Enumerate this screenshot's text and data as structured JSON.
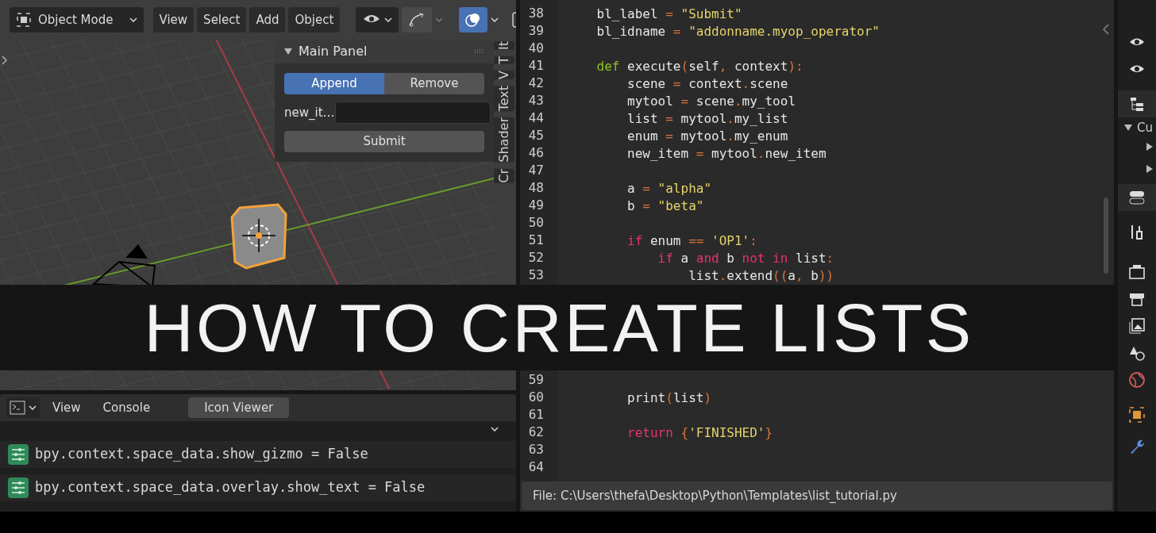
{
  "viewport": {
    "mode": "Object Mode",
    "menus": [
      "View",
      "Select",
      "Add",
      "Object"
    ],
    "overlays_on": true
  },
  "main_panel": {
    "title": "Main Panel",
    "expanded": true,
    "actions": [
      {
        "label": "Append",
        "selected": true
      },
      {
        "label": "Remove",
        "selected": false
      }
    ],
    "field_label": "new_it…",
    "submit": "Submit"
  },
  "sidebar_tabs": [
    "It",
    "T",
    "V",
    "Text",
    "Shader",
    "Cr"
  ],
  "console": {
    "menus": [
      "View",
      "Console"
    ],
    "tabs": [
      {
        "label": "Icon Viewer",
        "selected": true
      }
    ],
    "lines": [
      "bpy.context.space_data.show_gizmo = False",
      "bpy.context.space_data.overlay.show_text = False"
    ]
  },
  "text_editor": {
    "lines": [
      {
        "number": "38",
        "tokens": [
          {
            "text": "    bl_label ",
            "kind": "plain"
          },
          {
            "text": "=",
            "kind": "op"
          },
          {
            "text": " \"Submit\"",
            "kind": "str"
          }
        ]
      },
      {
        "number": "39",
        "tokens": [
          {
            "text": "    bl_idname ",
            "kind": "plain"
          },
          {
            "text": "=",
            "kind": "op"
          },
          {
            "text": " \"addonname.myop_operator\"",
            "kind": "str"
          }
        ]
      },
      {
        "number": "40"
      },
      {
        "number": "41",
        "tokens": [
          {
            "text": "    def",
            "kind": "def"
          },
          {
            "text": " execute",
            "kind": "plain"
          },
          {
            "text": "(",
            "kind": "op"
          },
          {
            "text": "self",
            "kind": "plain"
          },
          {
            "text": ",",
            "kind": "op"
          },
          {
            "text": " context",
            "kind": "plain"
          },
          {
            "text": "):",
            "kind": "op"
          }
        ]
      },
      {
        "number": "42",
        "tokens": [
          {
            "text": "        scene ",
            "kind": "plain"
          },
          {
            "text": "=",
            "kind": "op"
          },
          {
            "text": " context",
            "kind": "plain"
          },
          {
            "text": ".",
            "kind": "op"
          },
          {
            "text": "scene",
            "kind": "plain"
          }
        ]
      },
      {
        "number": "43",
        "tokens": [
          {
            "text": "        mytool ",
            "kind": "plain"
          },
          {
            "text": "=",
            "kind": "op"
          },
          {
            "text": " scene",
            "kind": "plain"
          },
          {
            "text": ".",
            "kind": "op"
          },
          {
            "text": "my_tool",
            "kind": "plain"
          }
        ]
      },
      {
        "number": "44",
        "tokens": [
          {
            "text": "        list ",
            "kind": "plain"
          },
          {
            "text": "=",
            "kind": "op"
          },
          {
            "text": " mytool",
            "kind": "plain"
          },
          {
            "text": ".",
            "kind": "op"
          },
          {
            "text": "my_list",
            "kind": "plain"
          }
        ]
      },
      {
        "number": "45",
        "tokens": [
          {
            "text": "        enum ",
            "kind": "plain"
          },
          {
            "text": "=",
            "kind": "op"
          },
          {
            "text": " mytool",
            "kind": "plain"
          },
          {
            "text": ".",
            "kind": "op"
          },
          {
            "text": "my_enum",
            "kind": "plain"
          }
        ]
      },
      {
        "number": "46",
        "tokens": [
          {
            "text": "        new_item ",
            "kind": "plain"
          },
          {
            "text": "=",
            "kind": "op"
          },
          {
            "text": " mytool",
            "kind": "plain"
          },
          {
            "text": ".",
            "kind": "op"
          },
          {
            "text": "new_item",
            "kind": "plain"
          }
        ]
      },
      {
        "number": "47"
      },
      {
        "number": "48",
        "tokens": [
          {
            "text": "        a ",
            "kind": "plain"
          },
          {
            "text": "=",
            "kind": "op"
          },
          {
            "text": " \"alpha\"",
            "kind": "str"
          }
        ]
      },
      {
        "number": "49",
        "tokens": [
          {
            "text": "        b ",
            "kind": "plain"
          },
          {
            "text": "=",
            "kind": "op"
          },
          {
            "text": " \"beta\"",
            "kind": "str"
          }
        ]
      },
      {
        "number": "50"
      },
      {
        "number": "51",
        "tokens": [
          {
            "text": "        if",
            "kind": "kw"
          },
          {
            "text": " enum ",
            "kind": "plain"
          },
          {
            "text": "==",
            "kind": "op"
          },
          {
            "text": " 'OP1'",
            "kind": "str"
          },
          {
            "text": ":",
            "kind": "op"
          }
        ]
      },
      {
        "number": "52",
        "tokens": [
          {
            "text": "            if",
            "kind": "kw"
          },
          {
            "text": " a ",
            "kind": "plain"
          },
          {
            "text": "and",
            "kind": "kw"
          },
          {
            "text": " b ",
            "kind": "plain"
          },
          {
            "text": "not in",
            "kind": "kw"
          },
          {
            "text": " list",
            "kind": "plain"
          },
          {
            "text": ":",
            "kind": "op"
          }
        ]
      },
      {
        "number": "53",
        "tokens": [
          {
            "text": "                list",
            "kind": "plain"
          },
          {
            "text": ".",
            "kind": "op"
          },
          {
            "text": "extend",
            "kind": "plain"
          },
          {
            "text": "((",
            "kind": "op"
          },
          {
            "text": "a",
            "kind": "plain"
          },
          {
            "text": ",",
            "kind": "op"
          },
          {
            "text": " b",
            "kind": "plain"
          },
          {
            "text": "))",
            "kind": "op"
          }
        ]
      }
    ],
    "lines_after_banner": [
      {
        "number": "59"
      },
      {
        "number": "60",
        "tokens": [
          {
            "text": "        print",
            "kind": "plain"
          },
          {
            "text": "(",
            "kind": "op"
          },
          {
            "text": "list",
            "kind": "plain"
          },
          {
            "text": ")",
            "kind": "op"
          }
        ]
      },
      {
        "number": "61"
      },
      {
        "number": "62",
        "tokens": [
          {
            "text": "        return",
            "kind": "kw"
          },
          {
            "text": " {",
            "kind": "op"
          },
          {
            "text": "'FINISHED'",
            "kind": "str"
          },
          {
            "text": "}",
            "kind": "op"
          }
        ]
      },
      {
        "number": "63"
      },
      {
        "number": "64"
      }
    ],
    "status": "File: C:\\Users\\thefa\\Desktop\\Python\\Templates\\list_tutorial.py"
  },
  "properties": {
    "outliner_item": "Cu"
  },
  "banner": {
    "title": "HOW TO CREATE LISTS"
  }
}
